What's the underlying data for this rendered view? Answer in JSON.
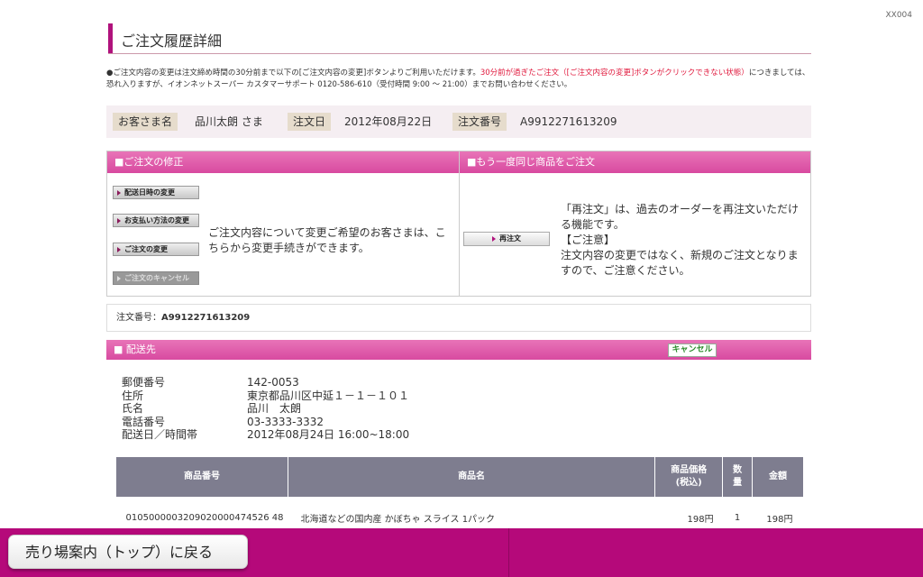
{
  "screen_id": "XX004",
  "page_title": "ご注文履歴詳細",
  "notice": {
    "part1": "●ご注文内容の変更は注文締め時間の30分前まで以下の[ご注文内容の変更]ボタンよりご利用いただけます。",
    "part2_red": "30分前が過ぎたご注文（[ご注文内容の変更]ボタンがクリックできない状態）",
    "part3": "につきましては、恐れ入りますが、イオンネットスーパー カスタマーサポート 0120-586-610（受付時間 9:00 ～ 21:00）までお問い合わせください。"
  },
  "info": {
    "customer_label": "お客さま名",
    "customer_value": "品川太朗 さま",
    "date_label": "注文日",
    "date_value": "2012年08月22日",
    "order_label": "注文番号",
    "order_value": "A9912271613209"
  },
  "modify_panel": {
    "header": "■ご注文の修正",
    "buttons": [
      "配送日時の変更",
      "お支払い方法の変更",
      "ご注文の変更",
      "ご注文のキャンセル"
    ],
    "description": "ご注文内容について変更ご希望のお客さまは、こちらから変更手続きができます。"
  },
  "reorder_panel": {
    "header": "■もう一度同じ商品をご注文",
    "button": "再注文",
    "desc_line1": "「再注文」は、過去のオーダーを再注文いただける機能です。",
    "desc_line2": "【ご注意】",
    "desc_line3": "注文内容の変更ではなく、新規のご注文となりますので、ご注意ください。"
  },
  "order_number_box": {
    "label": "注文番号：",
    "value": "A9912271613209"
  },
  "shipping": {
    "header": "■ 配送先",
    "cancel_label": "キャンセル",
    "rows": [
      {
        "key": "郵便番号",
        "value": "142-0053"
      },
      {
        "key": "住所",
        "value": "東京都品川区中延１－１－１０１"
      },
      {
        "key": "氏名",
        "value": "品川　太朗"
      },
      {
        "key": "電話番号",
        "value": "03-3333-3332"
      },
      {
        "key": "配送日／時間帯",
        "value": "2012年08月24日 16:00~18:00"
      }
    ]
  },
  "items_table": {
    "headers": {
      "product_no": "商品番号",
      "product_name": "商品名",
      "price": "商品価格\n(税込)",
      "qty": "数\n量",
      "amount": "金額"
    },
    "rows": [
      {
        "product_no": "0105000003209020000474526 48",
        "product_name": "北海道などの国内産 かぼちゃ スライス 1パック",
        "price": "198円",
        "qty": "1",
        "amount": "198円"
      }
    ]
  },
  "bottom": {
    "back_label": "売り場案内（トップ）に戻る"
  }
}
